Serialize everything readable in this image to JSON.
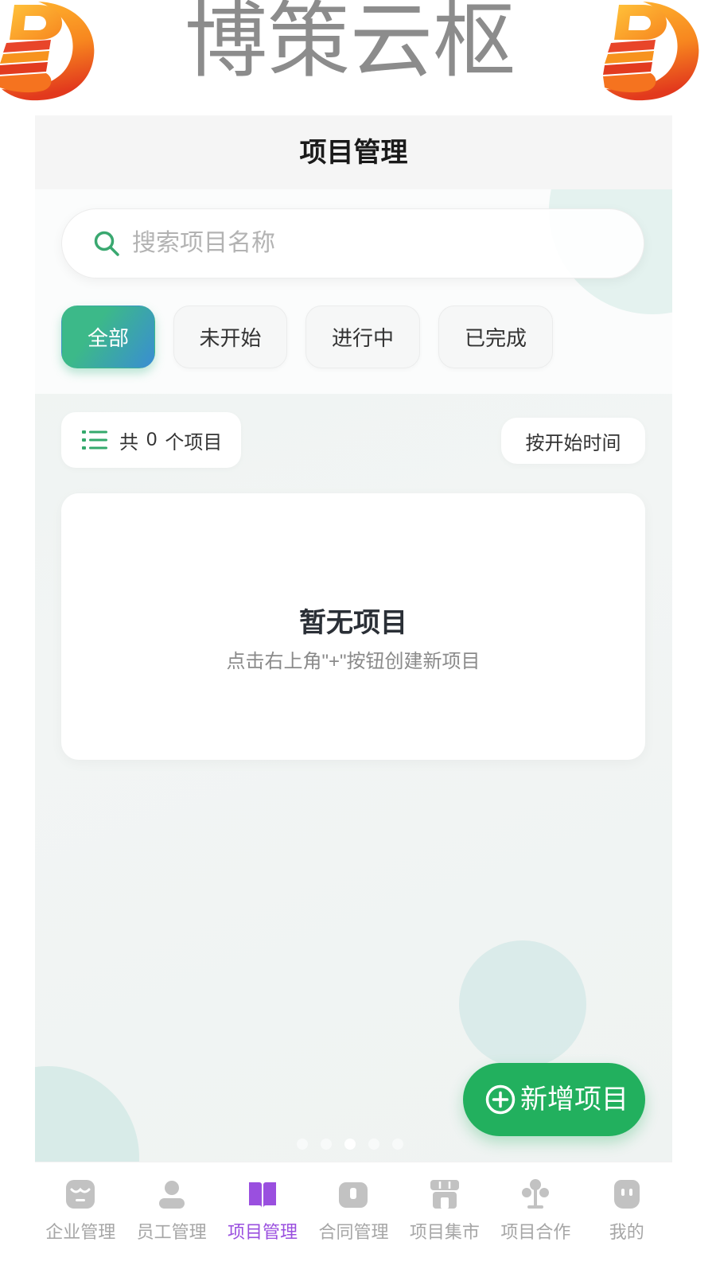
{
  "banner": {
    "title": "博策云枢",
    "logo_icon": "b-logo"
  },
  "header": {
    "title": "项目管理"
  },
  "search": {
    "icon": "search-icon",
    "placeholder": "搜索项目名称",
    "value": ""
  },
  "filters": {
    "active_index": 0,
    "items": [
      {
        "label": "全部"
      },
      {
        "label": "未开始"
      },
      {
        "label": "进行中"
      },
      {
        "label": "已完成"
      }
    ]
  },
  "summary": {
    "icon": "list-icon",
    "prefix": "共",
    "count": 0,
    "suffix": "个项目",
    "sort_label": "按开始时间"
  },
  "empty_state": {
    "title": "暂无项目",
    "hint": "点击右上角\"+\"按钮创建新项目"
  },
  "fab": {
    "icon": "plus-circle-icon",
    "label": "新增项目"
  },
  "page_indicator": {
    "count": 5,
    "active_index": 2
  },
  "tabbar": {
    "active_index": 2,
    "items": [
      {
        "label": "企业管理",
        "icon": "store-icon"
      },
      {
        "label": "员工管理",
        "icon": "user-icon"
      },
      {
        "label": "项目管理",
        "icon": "book-icon"
      },
      {
        "label": "合同管理",
        "icon": "contract-icon"
      },
      {
        "label": "项目集市",
        "icon": "market-icon"
      },
      {
        "label": "项目合作",
        "icon": "cooperation-icon"
      },
      {
        "label": "我的",
        "icon": "profile-icon"
      }
    ]
  },
  "colors": {
    "accent": "#22b05e",
    "tab_active": "#9a4fdf",
    "tab_inactive": "#c2c2c2",
    "filter_gradient_start": "#3cb989",
    "filter_gradient_end": "#3a8dd3",
    "banner_text": "#8c8c8c",
    "logo_orange": "#f7861f",
    "logo_red": "#e2391d"
  }
}
